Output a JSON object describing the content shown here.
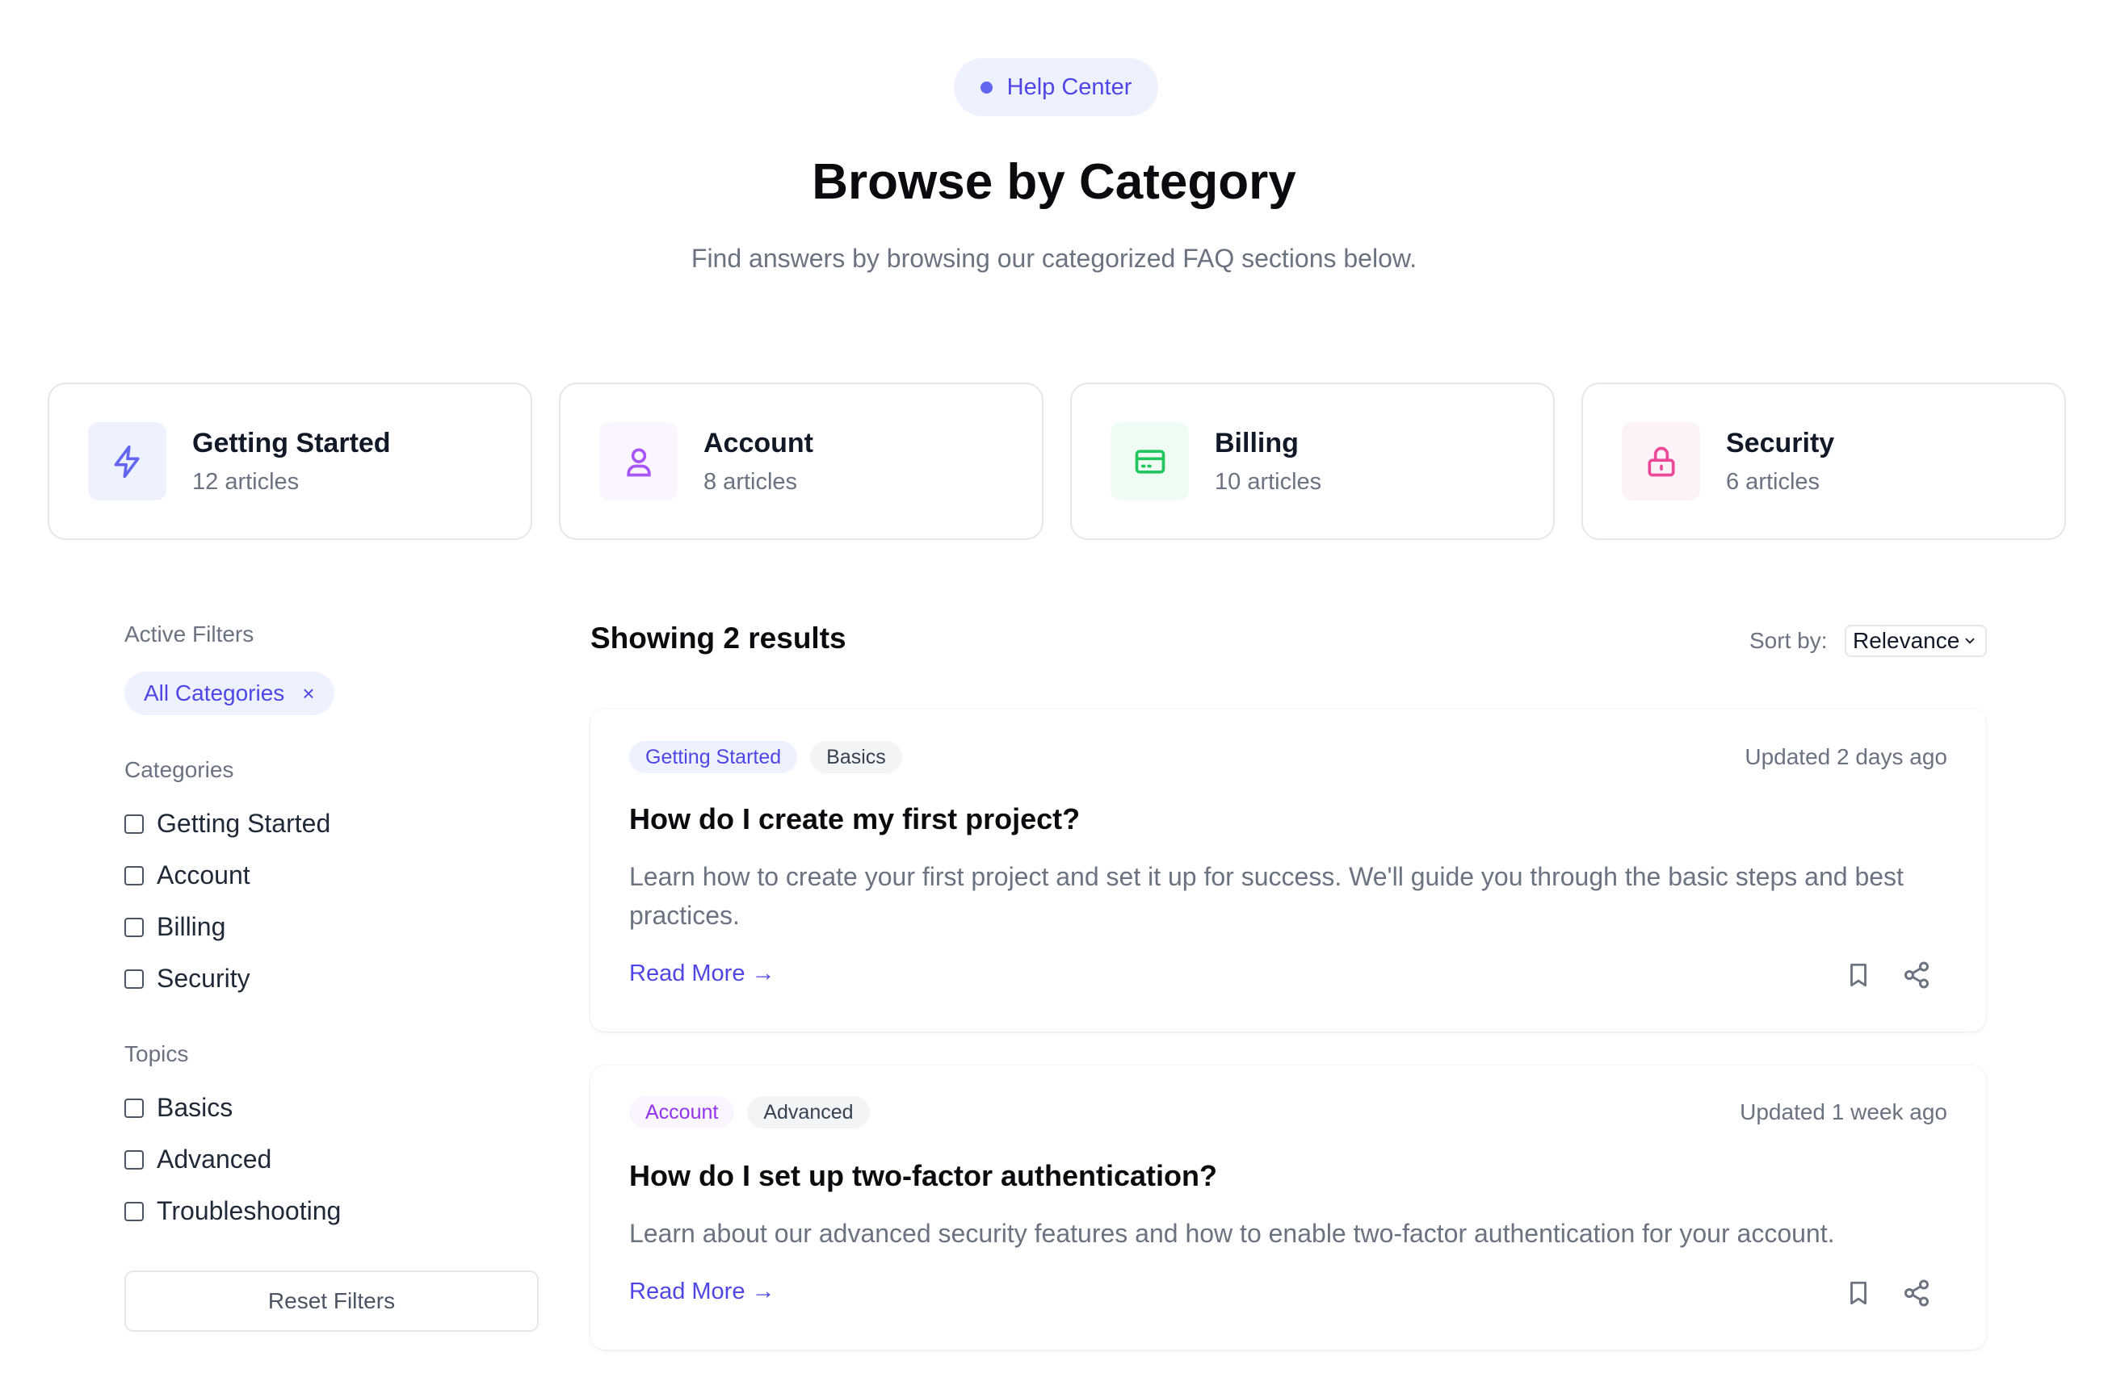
{
  "header": {
    "badge": "Help Center",
    "title": "Browse by Category",
    "subtitle": "Find answers by browsing our categorized FAQ sections below."
  },
  "categories": [
    {
      "title": "Getting Started",
      "count": "12 articles",
      "icon": "lightning-icon",
      "color": "#6366f1",
      "bg": "#eef2ff"
    },
    {
      "title": "Account",
      "count": "8 articles",
      "icon": "user-icon",
      "color": "#a855f7",
      "bg": "#faf5ff"
    },
    {
      "title": "Billing",
      "count": "10 articles",
      "icon": "credit-card-icon",
      "color": "#22c55e",
      "bg": "#f0fdf4"
    },
    {
      "title": "Security",
      "count": "6 articles",
      "icon": "lock-icon",
      "color": "#ec4899",
      "bg": "#fdf2f8"
    }
  ],
  "sidebar": {
    "active_filters_label": "Active Filters",
    "active_chip": "All Categories",
    "active_chip_remove": "×",
    "categories_label": "Categories",
    "categories": [
      "Getting Started",
      "Account",
      "Billing",
      "Security"
    ],
    "topics_label": "Topics",
    "topics": [
      "Basics",
      "Advanced",
      "Troubleshooting"
    ],
    "reset_label": "Reset Filters"
  },
  "results": {
    "title": "Showing 2 results",
    "sort_label": "Sort by:",
    "sort_value": "Relevance",
    "items": [
      {
        "tags": [
          "Getting Started",
          "Basics"
        ],
        "updated": "Updated 2 days ago",
        "question": "How do I create my first project?",
        "description": "Learn how to create your first project and set it up for success. We'll guide you through the basic steps and best practices.",
        "read_more": "Read More →"
      },
      {
        "tags": [
          "Account",
          "Advanced"
        ],
        "updated": "Updated 1 week ago",
        "question": "How do I set up two-factor authentication?",
        "description": "Learn about our advanced security features and how to enable two-factor authentication for your account.",
        "read_more": "Read More →"
      }
    ]
  },
  "colors": {
    "accent": "#4f46e5",
    "muted": "#6b7280",
    "border": "#e5e7eb"
  }
}
